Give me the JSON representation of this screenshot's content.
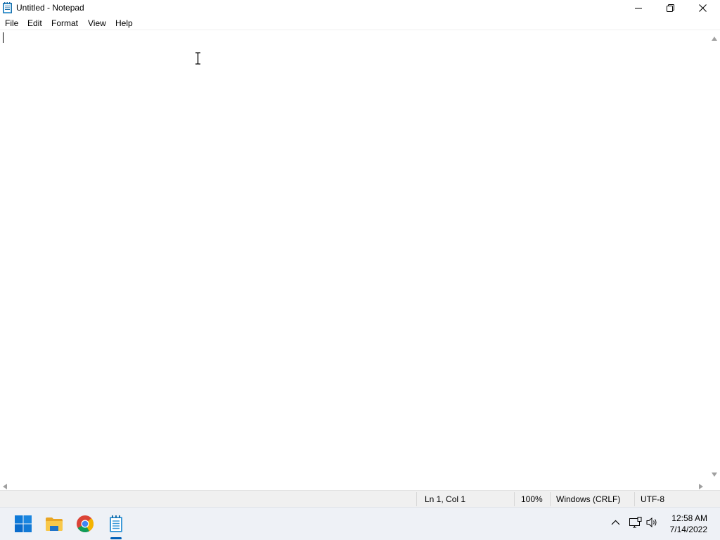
{
  "window": {
    "title": "Untitled - Notepad",
    "icon": "notepad-icon"
  },
  "window_controls": {
    "minimize_icon": "minimize-icon",
    "maximize_icon": "restore-icon",
    "close_icon": "close-icon"
  },
  "menu": {
    "items": [
      "File",
      "Edit",
      "Format",
      "View",
      "Help"
    ]
  },
  "editor": {
    "content": ""
  },
  "statusbar": {
    "position": "Ln 1, Col 1",
    "zoom": "100%",
    "line_ending": "Windows (CRLF)",
    "encoding": "UTF-8"
  },
  "taskbar": {
    "apps": [
      {
        "name": "Start",
        "icon": "windows-start-icon"
      },
      {
        "name": "File Explorer",
        "icon": "file-explorer-icon"
      },
      {
        "name": "Google Chrome",
        "icon": "chrome-icon"
      },
      {
        "name": "Notepad",
        "icon": "notepad-icon",
        "active": true
      }
    ],
    "tray": {
      "icons": [
        "chevron-up-icon",
        "network-icon",
        "volume-icon"
      ],
      "time": "12:58 AM",
      "date": "7/14/2022"
    }
  },
  "colors": {
    "accent": "#005fb8",
    "windows_blue": "#0078d4",
    "folder_yellow": "#f8c84a"
  }
}
